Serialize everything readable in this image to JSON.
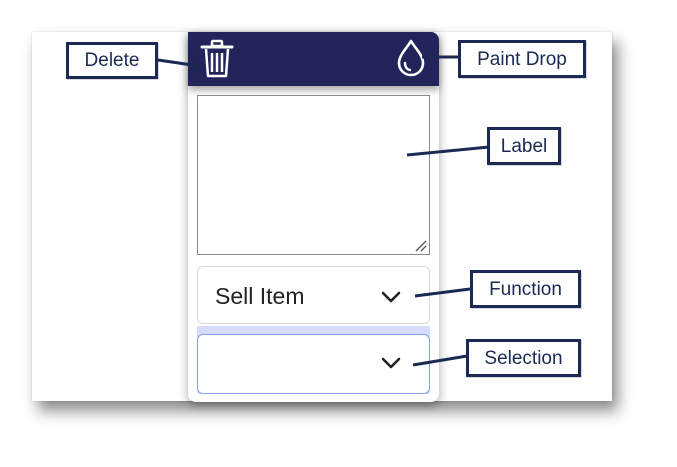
{
  "colors": {
    "header_bg": "#22245a",
    "callout_border": "#1b2a55",
    "selection_highlight": "#d6dcff",
    "selection_border": "#7fa6e8"
  },
  "toolbar": {
    "delete_icon": "trash-icon",
    "paint_icon": "paint-drop-icon"
  },
  "label_field": {
    "value": ""
  },
  "function_dropdown": {
    "selected": "Sell Item",
    "icon": "chevron-down-icon"
  },
  "selection_dropdown": {
    "selected": "",
    "icon": "chevron-down-icon"
  },
  "callouts": {
    "delete": "Delete",
    "paint_drop": "Paint Drop",
    "label": "Label",
    "function": "Function",
    "selection": "Selection"
  }
}
